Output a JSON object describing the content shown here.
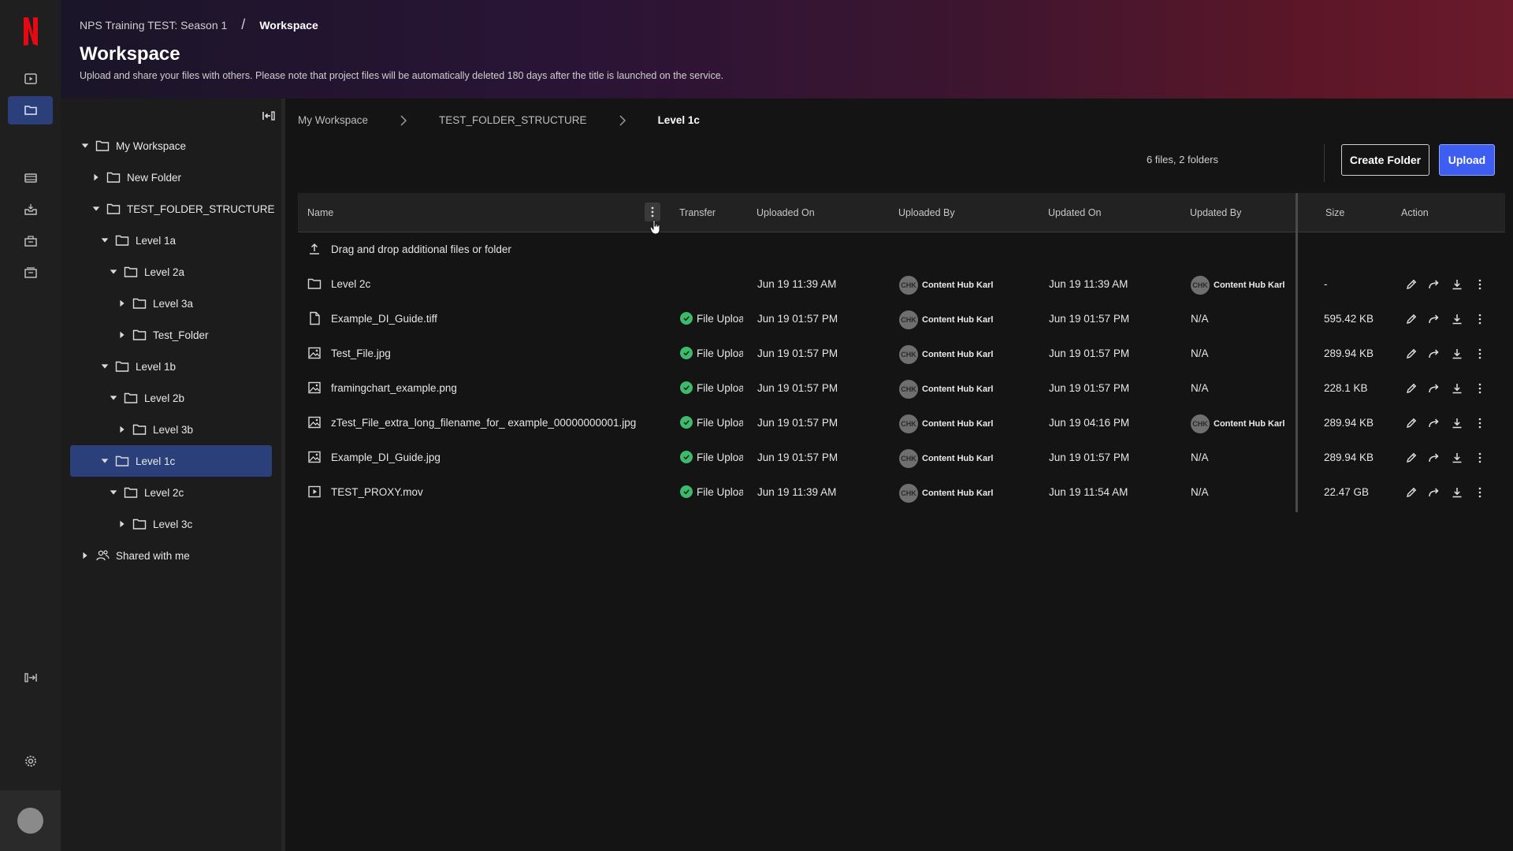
{
  "header": {
    "breadcrumb_project": "NPS Training TEST: Season 1",
    "breadcrumb_sep": "/",
    "breadcrumb_current": "Workspace",
    "title": "Workspace",
    "description": "Upload and share your files with others. Please note that project files will be automatically deleted 180 days after the title is launched on the service."
  },
  "tree": {
    "items": [
      {
        "label": "My Workspace",
        "expanded": true
      },
      {
        "label": "New Folder",
        "expanded": false
      },
      {
        "label": "TEST_FOLDER_STRUCTURE",
        "expanded": true
      },
      {
        "label": "Level 1a",
        "expanded": true
      },
      {
        "label": "Level 2a",
        "expanded": true
      },
      {
        "label": "Level 3a",
        "expanded": false
      },
      {
        "label": "Test_Folder",
        "expanded": false
      },
      {
        "label": "Level 1b",
        "expanded": true
      },
      {
        "label": "Level 2b",
        "expanded": true
      },
      {
        "label": "Level 3b",
        "expanded": false
      },
      {
        "label": "Level 1c",
        "expanded": true,
        "selected": true
      },
      {
        "label": "Level 2c",
        "expanded": true
      },
      {
        "label": "Level 3c",
        "expanded": false
      },
      {
        "label": "Shared with me",
        "expanded": false
      }
    ]
  },
  "breadcrumb": {
    "root": "My Workspace",
    "middle": "TEST_FOLDER_STRUCTURE",
    "current": "Level 1c"
  },
  "toolbar": {
    "counts": "6 files, 2 folders",
    "create_folder_label": "Create Folder",
    "upload_label": "Upload"
  },
  "table": {
    "columns": {
      "name": "Name",
      "transfer": "Transfer",
      "uploaded_on": "Uploaded On",
      "uploaded_by": "Uploaded By",
      "updated_on": "Updated On",
      "updated_by": "Updated By",
      "size": "Size",
      "action": "Action"
    },
    "dropzone": "Drag and drop additional files or folder",
    "rows": [
      {
        "name": "Level 2c",
        "icon": "folder-icon",
        "transfer": "",
        "uploaded_on": "Jun 19 11:39 AM",
        "uploaded_by": "Content Hub Karl",
        "updated_on": "Jun 19 11:39 AM",
        "updated_by": "Content Hub Karl",
        "size": "-"
      },
      {
        "name": "Example_DI_Guide.tiff",
        "icon": "file-icon",
        "transfer": "File Uploaded",
        "uploaded_on": "Jun 19 01:57 PM",
        "uploaded_by": "Content Hub Karl",
        "updated_on": "Jun 19 01:57 PM",
        "updated_by": "N/A",
        "size": "595.42 KB"
      },
      {
        "name": "Test_File.jpg",
        "icon": "image-icon",
        "transfer": "File Uploaded",
        "uploaded_on": "Jun 19 01:57 PM",
        "uploaded_by": "Content Hub Karl",
        "updated_on": "Jun 19 01:57 PM",
        "updated_by": "N/A",
        "size": "289.94 KB"
      },
      {
        "name": "framingchart_example.png",
        "icon": "image-icon",
        "transfer": "File Uploaded",
        "uploaded_on": "Jun 19 01:57 PM",
        "uploaded_by": "Content Hub Karl",
        "updated_on": "Jun 19 01:57 PM",
        "updated_by": "N/A",
        "size": "228.1 KB"
      },
      {
        "name": "zTest_File_extra_long_filename_for_ example_00000000001.jpg",
        "icon": "image-icon",
        "transfer": "File Uploaded",
        "uploaded_on": "Jun 19 01:57 PM",
        "uploaded_by": "Content Hub Karl",
        "updated_on": "Jun 19 04:16 PM",
        "updated_by": "Content Hub Karl",
        "size": "289.94 KB"
      },
      {
        "name": "Example_DI_Guide.jpg",
        "icon": "image-icon",
        "transfer": "File Uploaded",
        "uploaded_on": "Jun 19 01:57 PM",
        "uploaded_by": "Content Hub Karl",
        "updated_on": "Jun 19 01:57 PM",
        "updated_by": "N/A",
        "size": "289.94 KB"
      },
      {
        "name": "TEST_PROXY.mov",
        "icon": "video-icon",
        "transfer": "File Uploaded",
        "uploaded_on": "Jun 19 11:39 AM",
        "uploaded_by": "Content Hub Karl",
        "updated_on": "Jun 19 11:54 AM",
        "updated_by": "N/A",
        "size": "22.47 GB"
      }
    ],
    "avatar_initials": "CHK"
  },
  "colors": {
    "accent": "#3d5ef0",
    "selected": "#2b3f7a",
    "success": "#3fb96b",
    "brand": "#e50914"
  }
}
